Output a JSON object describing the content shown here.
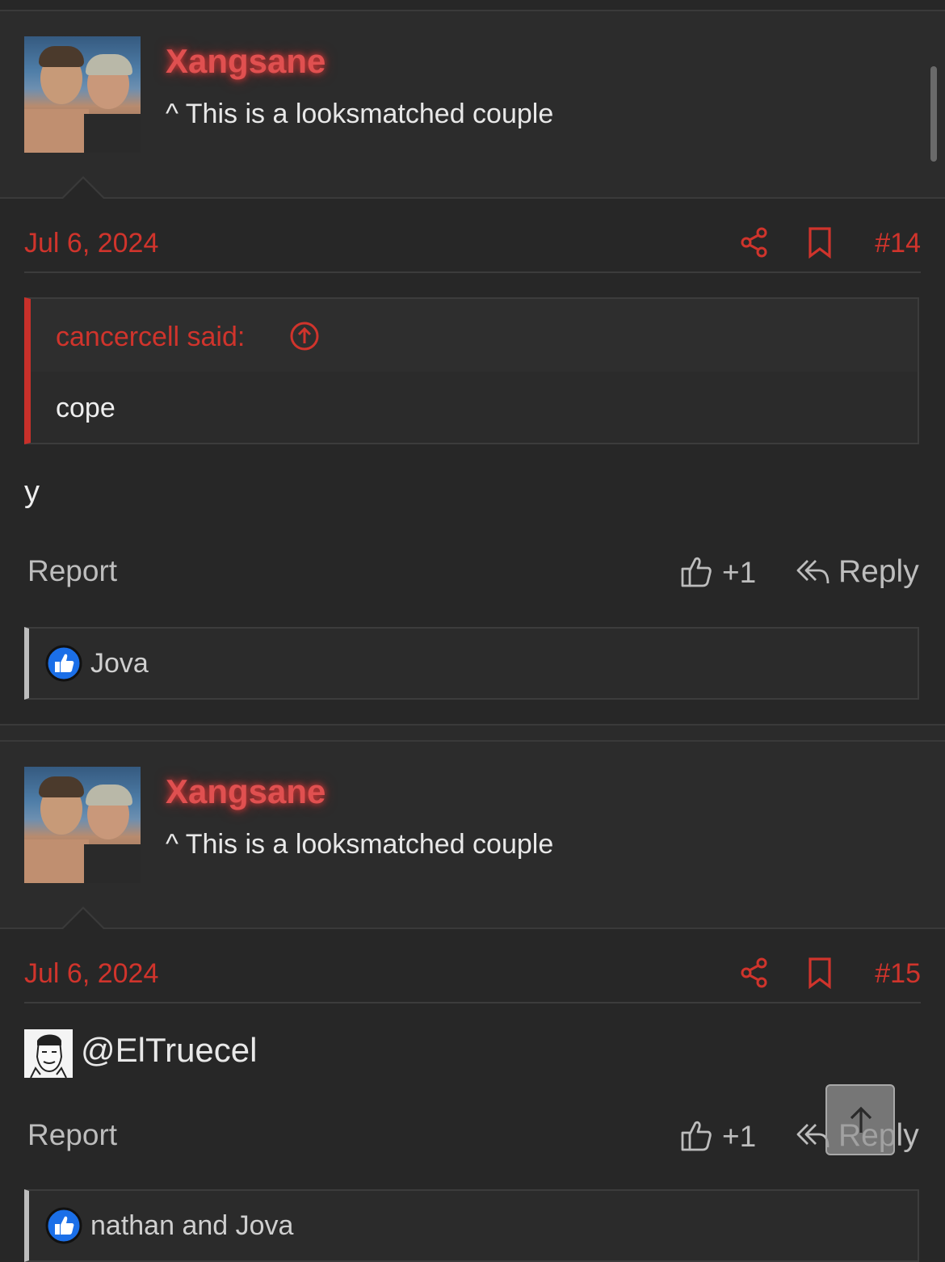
{
  "posts": [
    {
      "username": "Xangsane",
      "user_title": "^ This is a looksmatched couple",
      "date": "Jul 6, 2024",
      "post_number": "#14",
      "quote": {
        "author": "cancercell said:",
        "text": "cope"
      },
      "message": "y",
      "actions": {
        "report": "Report",
        "like_count": "+1",
        "reply": "Reply"
      },
      "reactions": {
        "users": "Jova"
      }
    },
    {
      "username": "Xangsane",
      "user_title": "^ This is a looksmatched couple",
      "date": "Jul 6, 2024",
      "post_number": "#15",
      "mention": "@ElTruecel",
      "actions": {
        "report": "Report",
        "like_count": "+1",
        "reply": "Reply"
      },
      "reactions": {
        "users": "nathan and Jova"
      }
    }
  ],
  "icons": {
    "share": "share-icon",
    "bookmark": "bookmark-icon",
    "like": "thumbs-up-icon",
    "reply": "reply-arrow-icon",
    "quote_jump": "arrow-up-circle-icon",
    "scroll_top": "arrow-up-icon"
  },
  "colors": {
    "accent": "#d0342c",
    "background": "#272727",
    "username_glow": "#ff3c3c"
  }
}
